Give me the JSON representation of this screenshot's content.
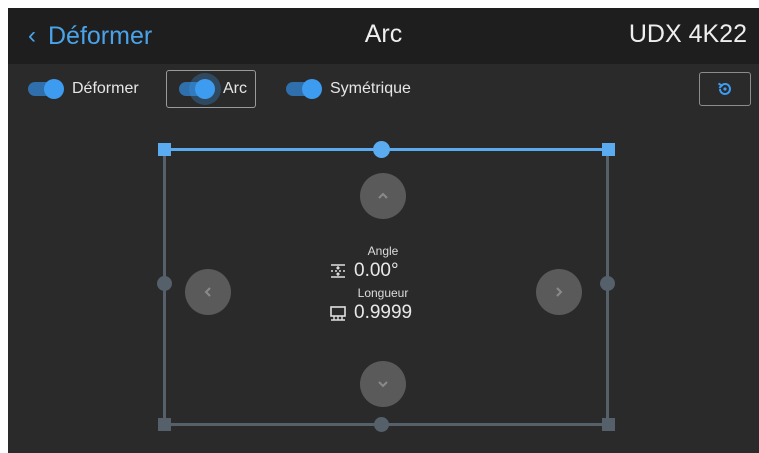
{
  "header": {
    "back_label": "Déformer",
    "title": "Arc",
    "model": "UDX 4K22"
  },
  "toolbar": {
    "toggles": [
      {
        "label": "Déformer",
        "on": true
      },
      {
        "label": "Arc",
        "on": true,
        "selected": true
      },
      {
        "label": "Symétrique",
        "on": true
      }
    ]
  },
  "controls": {
    "angle_label": "Angle",
    "angle_value": "0.00°",
    "length_label": "Longueur",
    "length_value": "0.9999"
  },
  "colors": {
    "accent": "#3d9cf0",
    "frame": "#56606b",
    "active_edge": "#5aabf0",
    "background": "#2a2a2a",
    "header": "#1e1e1e"
  },
  "icons": {
    "back": "chevron-left-icon",
    "reset": "reset-icon",
    "up": "chevron-up-icon",
    "down": "chevron-down-icon",
    "left": "chevron-left-icon",
    "right": "chevron-right-icon",
    "angle": "angle-icon",
    "length": "length-icon"
  }
}
